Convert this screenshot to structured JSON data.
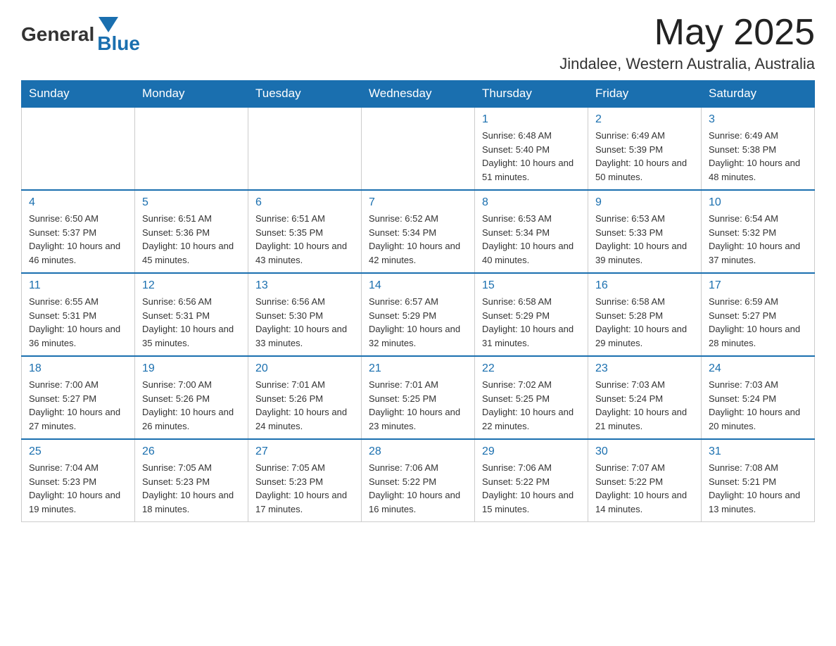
{
  "header": {
    "logo_general": "General",
    "logo_blue": "Blue",
    "month_title": "May 2025",
    "location": "Jindalee, Western Australia, Australia"
  },
  "days_of_week": [
    "Sunday",
    "Monday",
    "Tuesday",
    "Wednesday",
    "Thursday",
    "Friday",
    "Saturday"
  ],
  "weeks": [
    {
      "days": [
        {
          "number": "",
          "sunrise": "",
          "sunset": "",
          "daylight": ""
        },
        {
          "number": "",
          "sunrise": "",
          "sunset": "",
          "daylight": ""
        },
        {
          "number": "",
          "sunrise": "",
          "sunset": "",
          "daylight": ""
        },
        {
          "number": "",
          "sunrise": "",
          "sunset": "",
          "daylight": ""
        },
        {
          "number": "1",
          "sunrise": "6:48 AM",
          "sunset": "5:40 PM",
          "daylight": "10 hours and 51 minutes."
        },
        {
          "number": "2",
          "sunrise": "6:49 AM",
          "sunset": "5:39 PM",
          "daylight": "10 hours and 50 minutes."
        },
        {
          "number": "3",
          "sunrise": "6:49 AM",
          "sunset": "5:38 PM",
          "daylight": "10 hours and 48 minutes."
        }
      ]
    },
    {
      "days": [
        {
          "number": "4",
          "sunrise": "6:50 AM",
          "sunset": "5:37 PM",
          "daylight": "10 hours and 46 minutes."
        },
        {
          "number": "5",
          "sunrise": "6:51 AM",
          "sunset": "5:36 PM",
          "daylight": "10 hours and 45 minutes."
        },
        {
          "number": "6",
          "sunrise": "6:51 AM",
          "sunset": "5:35 PM",
          "daylight": "10 hours and 43 minutes."
        },
        {
          "number": "7",
          "sunrise": "6:52 AM",
          "sunset": "5:34 PM",
          "daylight": "10 hours and 42 minutes."
        },
        {
          "number": "8",
          "sunrise": "6:53 AM",
          "sunset": "5:34 PM",
          "daylight": "10 hours and 40 minutes."
        },
        {
          "number": "9",
          "sunrise": "6:53 AM",
          "sunset": "5:33 PM",
          "daylight": "10 hours and 39 minutes."
        },
        {
          "number": "10",
          "sunrise": "6:54 AM",
          "sunset": "5:32 PM",
          "daylight": "10 hours and 37 minutes."
        }
      ]
    },
    {
      "days": [
        {
          "number": "11",
          "sunrise": "6:55 AM",
          "sunset": "5:31 PM",
          "daylight": "10 hours and 36 minutes."
        },
        {
          "number": "12",
          "sunrise": "6:56 AM",
          "sunset": "5:31 PM",
          "daylight": "10 hours and 35 minutes."
        },
        {
          "number": "13",
          "sunrise": "6:56 AM",
          "sunset": "5:30 PM",
          "daylight": "10 hours and 33 minutes."
        },
        {
          "number": "14",
          "sunrise": "6:57 AM",
          "sunset": "5:29 PM",
          "daylight": "10 hours and 32 minutes."
        },
        {
          "number": "15",
          "sunrise": "6:58 AM",
          "sunset": "5:29 PM",
          "daylight": "10 hours and 31 minutes."
        },
        {
          "number": "16",
          "sunrise": "6:58 AM",
          "sunset": "5:28 PM",
          "daylight": "10 hours and 29 minutes."
        },
        {
          "number": "17",
          "sunrise": "6:59 AM",
          "sunset": "5:27 PM",
          "daylight": "10 hours and 28 minutes."
        }
      ]
    },
    {
      "days": [
        {
          "number": "18",
          "sunrise": "7:00 AM",
          "sunset": "5:27 PM",
          "daylight": "10 hours and 27 minutes."
        },
        {
          "number": "19",
          "sunrise": "7:00 AM",
          "sunset": "5:26 PM",
          "daylight": "10 hours and 26 minutes."
        },
        {
          "number": "20",
          "sunrise": "7:01 AM",
          "sunset": "5:26 PM",
          "daylight": "10 hours and 24 minutes."
        },
        {
          "number": "21",
          "sunrise": "7:01 AM",
          "sunset": "5:25 PM",
          "daylight": "10 hours and 23 minutes."
        },
        {
          "number": "22",
          "sunrise": "7:02 AM",
          "sunset": "5:25 PM",
          "daylight": "10 hours and 22 minutes."
        },
        {
          "number": "23",
          "sunrise": "7:03 AM",
          "sunset": "5:24 PM",
          "daylight": "10 hours and 21 minutes."
        },
        {
          "number": "24",
          "sunrise": "7:03 AM",
          "sunset": "5:24 PM",
          "daylight": "10 hours and 20 minutes."
        }
      ]
    },
    {
      "days": [
        {
          "number": "25",
          "sunrise": "7:04 AM",
          "sunset": "5:23 PM",
          "daylight": "10 hours and 19 minutes."
        },
        {
          "number": "26",
          "sunrise": "7:05 AM",
          "sunset": "5:23 PM",
          "daylight": "10 hours and 18 minutes."
        },
        {
          "number": "27",
          "sunrise": "7:05 AM",
          "sunset": "5:23 PM",
          "daylight": "10 hours and 17 minutes."
        },
        {
          "number": "28",
          "sunrise": "7:06 AM",
          "sunset": "5:22 PM",
          "daylight": "10 hours and 16 minutes."
        },
        {
          "number": "29",
          "sunrise": "7:06 AM",
          "sunset": "5:22 PM",
          "daylight": "10 hours and 15 minutes."
        },
        {
          "number": "30",
          "sunrise": "7:07 AM",
          "sunset": "5:22 PM",
          "daylight": "10 hours and 14 minutes."
        },
        {
          "number": "31",
          "sunrise": "7:08 AM",
          "sunset": "5:21 PM",
          "daylight": "10 hours and 13 minutes."
        }
      ]
    }
  ]
}
